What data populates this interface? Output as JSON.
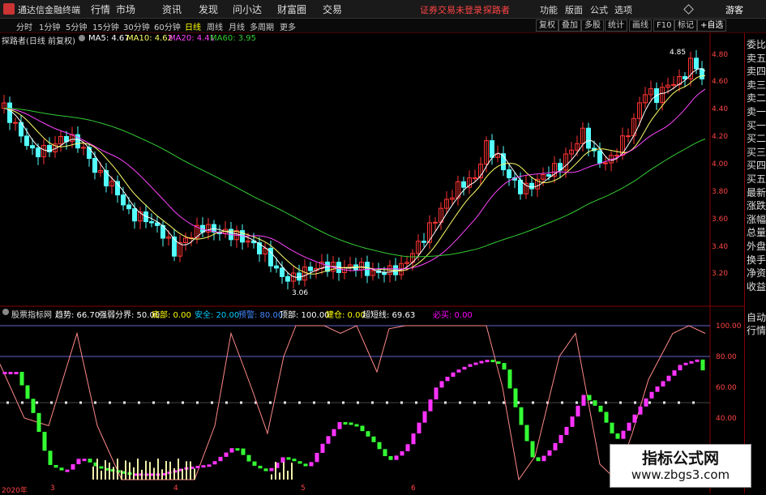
{
  "titlebar": {
    "app_name": "通达信金融终端",
    "menus": [
      "行情",
      "市场",
      "资讯",
      "发现",
      "问小达",
      "财富圈",
      "交易"
    ],
    "login_notice": "证券交易未登录",
    "user": "探路者",
    "right_menus": [
      "功能",
      "版面",
      "公式",
      "选项"
    ],
    "guest": "游客"
  },
  "toolbar": {
    "periods": [
      "分时",
      "1分钟",
      "5分钟",
      "15分钟",
      "30分钟",
      "60分钟",
      "日线",
      "周线",
      "月线",
      "多周期",
      "更多"
    ],
    "active_period": "日线",
    "tools": [
      "复权",
      "叠加",
      "多股",
      "统计",
      "画线",
      "F10",
      "标记",
      "+自选"
    ]
  },
  "main_info": {
    "stock": "探路者(日线 前复权)",
    "ma5": "MA5: 4.67",
    "ma10": "MA10: 4.62",
    "ma20": "MA20: 4.41",
    "ma60": "MA60: 3.95"
  },
  "price_axis": [
    "4.80",
    "4.60",
    "4.40",
    "4.20",
    "4.00",
    "3.80",
    "3.60",
    "3.40",
    "3.20"
  ],
  "annotations": {
    "high": "4.85",
    "low": "3.06"
  },
  "sub_info": {
    "name": "股票指标网",
    "items": [
      {
        "text": "趋势: 66.70",
        "color": "#ffffff"
      },
      {
        "text": "强弱分界: 50.00",
        "color": "#ffffff"
      },
      {
        "text": "底部: 0.00",
        "color": "#ffff00"
      },
      {
        "text": "安全: 20.00",
        "color": "#00ccff"
      },
      {
        "text": "预警: 80.00",
        "color": "#4488ff"
      },
      {
        "text": "顶部: 100.00",
        "color": "#ffffff"
      },
      {
        "text": "建仓: 0.00",
        "color": "#ffff00"
      },
      {
        "text": "超短线: 69.63",
        "color": "#ffffff"
      },
      {
        "text": "必买: 0.00",
        "color": "#ff00ff"
      }
    ]
  },
  "ind_axis": [
    "100.00",
    "80.00",
    "60.00",
    "40.00"
  ],
  "date_axis": {
    "year": "2020年",
    "months": [
      "3",
      "4",
      "5",
      "6"
    ]
  },
  "right_panel": [
    "委比",
    "卖五",
    "卖四",
    "卖三",
    "卖二",
    "卖一",
    "买一",
    "买二",
    "买三",
    "买四",
    "买五",
    "最新",
    "涨跌",
    "涨幅",
    "总量",
    "外盘",
    "换手",
    "净资",
    "收益"
  ],
  "right_panel_bottom": [
    "自动",
    "行情"
  ],
  "watermark": {
    "title": "指标公式网",
    "url": "www.zbgs3.com"
  },
  "colors": {
    "up": "#ff3333",
    "down": "#54ffff",
    "ma5": "#ffffff",
    "ma10": "#ffff66",
    "ma20": "#ff44ff",
    "ma60": "#33cc33"
  }
}
